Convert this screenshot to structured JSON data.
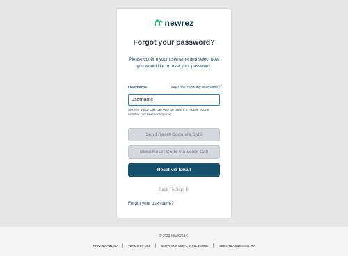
{
  "brand": {
    "name": "newrez",
    "accent_color": "#2bb673",
    "dark_color": "#0e3a4f"
  },
  "form": {
    "title": "Forgot your password?",
    "subtitle": "Please confirm your username and select how you would like to reset your password.",
    "username_label": "Username",
    "username_help_link": "How do I know my username?",
    "username_value": "username",
    "hint": "SMS or Voice Call can only be used if a mobile phone number has been configured.",
    "sms_button": "Send Reset Code via SMS",
    "voice_button": "Send Reset Code via Voice Call",
    "email_button": "Reset via Email",
    "back_link": "Back To Sign In",
    "forgot_username_link": "Forgot your username?"
  },
  "footer": {
    "copyright": "© 2023 Newrez LLC",
    "links": [
      "PRIVACY POLICY",
      "TERMS OF USE",
      "SERVICING LEGAL DISCLOSURE",
      "WEBSITE ACCESSIBILITY"
    ]
  }
}
